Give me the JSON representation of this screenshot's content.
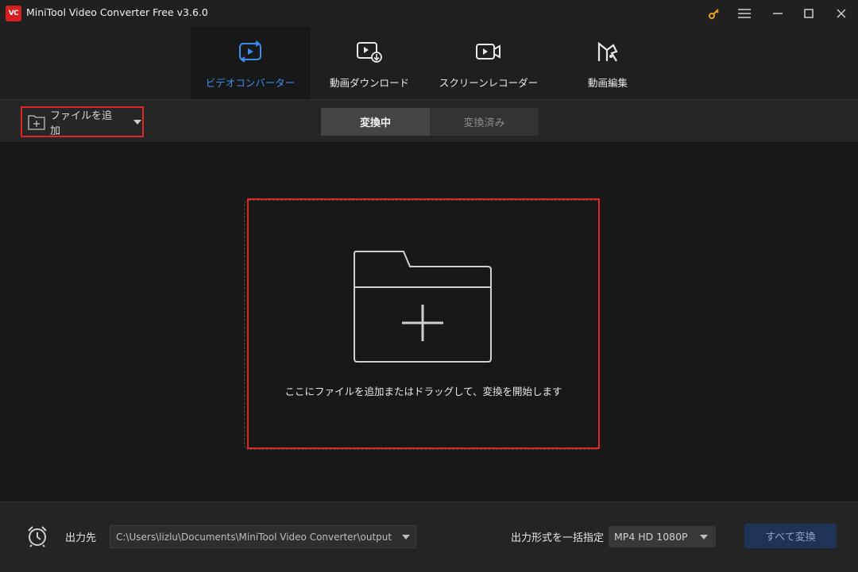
{
  "app": {
    "logo_text": "VC",
    "title": "MiniTool Video Converter Free v3.6.0"
  },
  "window_controls": [
    "key-icon",
    "menu-icon",
    "minimize-icon",
    "maximize-icon",
    "close-icon"
  ],
  "nav": {
    "items": [
      {
        "label": "ビデオコンバーター",
        "icon": "convert-icon",
        "active": true
      },
      {
        "label": "動画ダウンロード",
        "icon": "download-icon",
        "active": false
      },
      {
        "label": "スクリーンレコーダー",
        "icon": "camera-icon",
        "active": false
      },
      {
        "label": "動画編集",
        "icon": "edit-icon",
        "active": false
      }
    ]
  },
  "toolbar": {
    "add_file_label": "ファイルを追加",
    "tabs": [
      {
        "label": "変換中",
        "active": true
      },
      {
        "label": "変換済み",
        "active": false
      }
    ]
  },
  "drop_zone": {
    "text": "ここにファイルを追加またはドラッグして、変換を開始します"
  },
  "footer": {
    "output_label": "出力先",
    "output_path": "C:\\Users\\lizlu\\Documents\\MiniTool Video Converter\\output",
    "format_label": "出力形式を一括指定",
    "format_value": "MP4 HD 1080P",
    "convert_all_label": "すべて変換"
  },
  "colors": {
    "accent": "#3a8ef0",
    "highlight_border": "#e02525",
    "logo_red": "#d71f1f"
  }
}
